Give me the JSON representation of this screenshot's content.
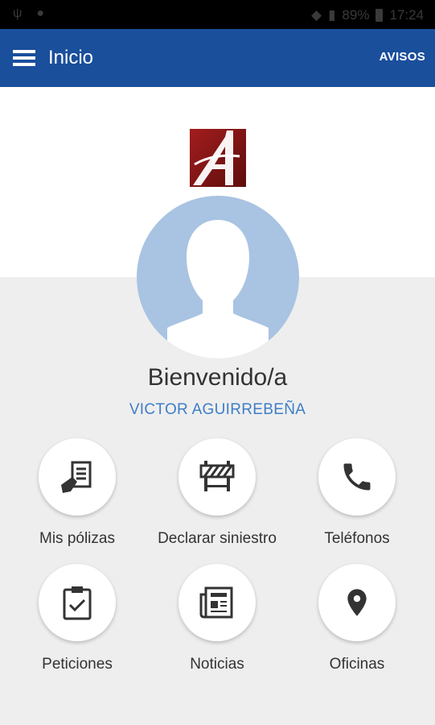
{
  "status_bar": {
    "battery": "89%",
    "time": "17:24"
  },
  "app_bar": {
    "title": "Inicio",
    "action": "AVISOS"
  },
  "welcome": {
    "greeting": "Bienvenido/a",
    "user_name": "VICTOR AGUIRREBEÑA"
  },
  "menu": [
    {
      "label": "Mis pólizas",
      "icon": "policy-document-icon"
    },
    {
      "label": "Declarar siniestro",
      "icon": "barrier-icon"
    },
    {
      "label": "Teléfonos",
      "icon": "phone-icon"
    },
    {
      "label": "Peticiones",
      "icon": "clipboard-check-icon"
    },
    {
      "label": "Noticias",
      "icon": "newspaper-icon"
    },
    {
      "label": "Oficinas",
      "icon": "location-pin-icon"
    }
  ],
  "colors": {
    "primary": "#1a4f9c",
    "accent": "#3d7ec7",
    "avatar": "#a9c3e2",
    "logo": "#8b1a1a"
  }
}
